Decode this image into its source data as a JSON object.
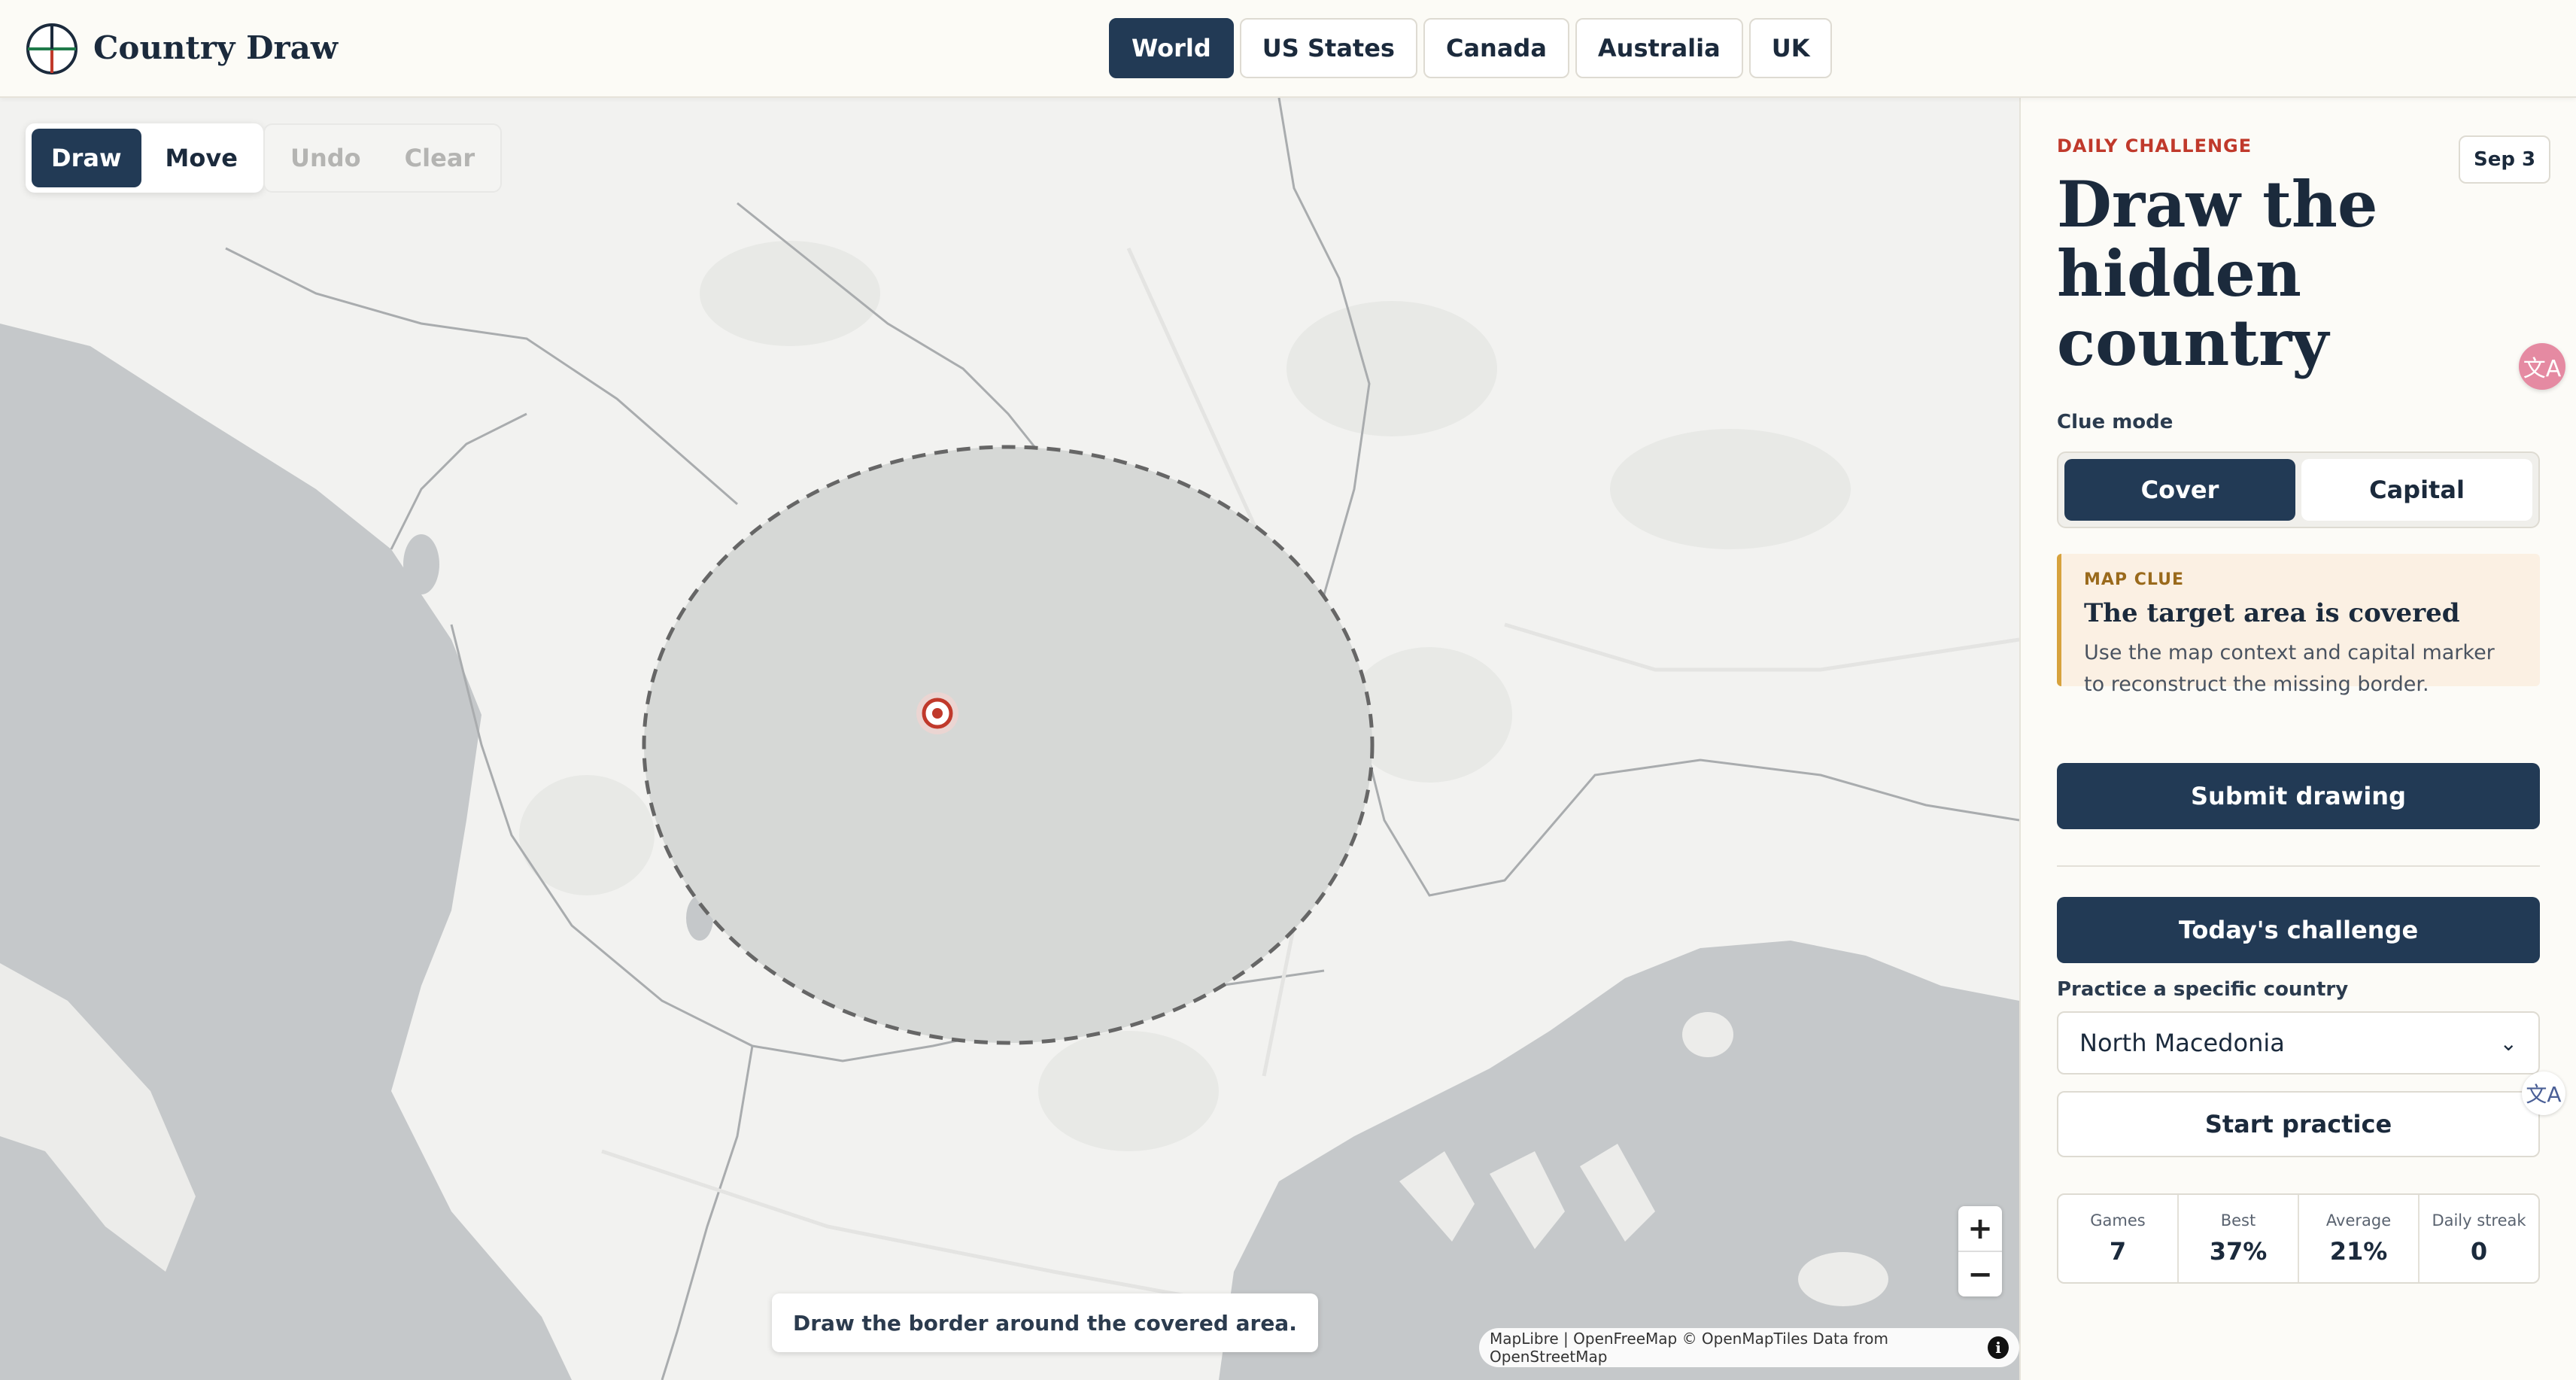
{
  "header": {
    "app_title": "Country Draw",
    "tabs": [
      {
        "label": "World",
        "active": true
      },
      {
        "label": "US States",
        "active": false
      },
      {
        "label": "Canada",
        "active": false
      },
      {
        "label": "Australia",
        "active": false
      },
      {
        "label": "UK",
        "active": false
      }
    ]
  },
  "map": {
    "tools": {
      "draw": "Draw",
      "move": "Move",
      "undo": "Undo",
      "clear": "Clear",
      "active_tool": "Draw"
    },
    "zoom_in": "+",
    "zoom_out": "−",
    "hint": "Draw the border around the covered area.",
    "attribution": "MapLibre | OpenFreeMap © OpenMapTiles Data from OpenStreetMap",
    "info_glyph": "i"
  },
  "sidebar": {
    "eyebrow": "DAILY CHALLENGE",
    "date": "Sep 3",
    "headline": "Draw the hidden country",
    "clue_mode_label": "Clue mode",
    "clue_modes": [
      {
        "label": "Cover",
        "active": true
      },
      {
        "label": "Capital",
        "active": false
      }
    ],
    "clue_card": {
      "eyebrow": "MAP CLUE",
      "title": "The target area is covered",
      "body": "Use the map context and capital marker to reconstruct the missing border."
    },
    "submit_label": "Submit drawing",
    "today_label": "Today's challenge",
    "practice_label": "Practice a specific country",
    "practice_selected": "North Macedonia",
    "start_practice_label": "Start practice",
    "stats": [
      {
        "label": "Games",
        "value": "7"
      },
      {
        "label": "Best",
        "value": "37%"
      },
      {
        "label": "Average",
        "value": "21%"
      },
      {
        "label": "Daily streak",
        "value": "0"
      }
    ],
    "translate_glyph": "文A"
  },
  "colors": {
    "primary": "#223a55",
    "accent_red": "#c0392b",
    "clue_bg": "#fbf0e3",
    "clue_border": "#d7a23d",
    "water": "#c5c8ca",
    "land": "#f2f2f0"
  }
}
